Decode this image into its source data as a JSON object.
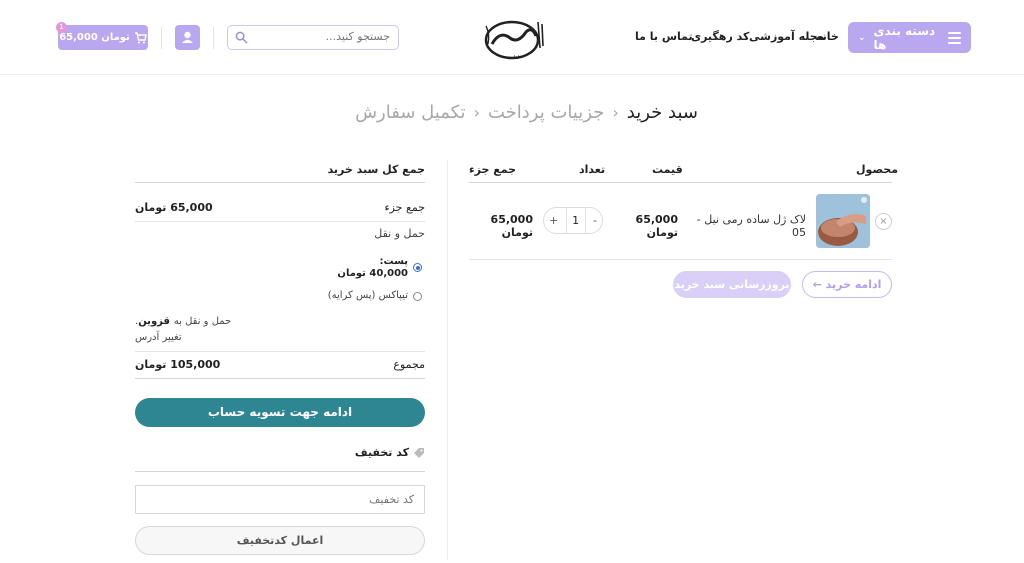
{
  "header": {
    "categories_label": "دسته بندی ها",
    "nav": [
      "خانه",
      "مجله آموزشی",
      "کد رهگیری",
      "تماس با ما"
    ],
    "logo_text": "اقاصد",
    "search_placeholder": "جستجو کنید...",
    "cart_total": "65,000 تومان",
    "cart_count": "1",
    "accent_color": "#b9a7ef"
  },
  "breadcrumb": {
    "current": "سبد خرید",
    "steps": [
      "جزییات پرداخت",
      "تکمیل سفارش"
    ]
  },
  "cart_table": {
    "columns": {
      "product": "محصول",
      "price": "قیمت",
      "quantity": "تعداد",
      "subtotal": "جمع جزء"
    },
    "items": [
      {
        "name": "لاک ژل ساده رمی نیل - 05",
        "price": "65,000 تومان",
        "quantity": "1",
        "subtotal": "65,000 تومان"
      }
    ],
    "update_button": "بروزرسانی سبد خرید",
    "continue_button": "ادامه خرید"
  },
  "totals": {
    "title": "جمع کل سبد خرید",
    "subtotal_label": "جمع جزء",
    "subtotal_value": "65,000 تومان",
    "shipping_label": "حمل و نقل",
    "options": [
      {
        "label": "پست:",
        "price": "40,000 تومان",
        "selected": true
      },
      {
        "label": "تیپاکس (پس کرایه)",
        "selected": false
      }
    ],
    "shipping_to": "حمل و نقل به",
    "city": "قزوین",
    "change_address": "تغییر آدرس",
    "total_label": "مجموع",
    "total_value": "105,000 تومان",
    "checkout_button": "ادامه جهت تسویه حساب",
    "checkout_color": "#2d8691"
  },
  "coupon": {
    "title": "کد تخفیف",
    "placeholder": "کد تخفیف",
    "apply_button": "اعمال کدتخفیف"
  }
}
